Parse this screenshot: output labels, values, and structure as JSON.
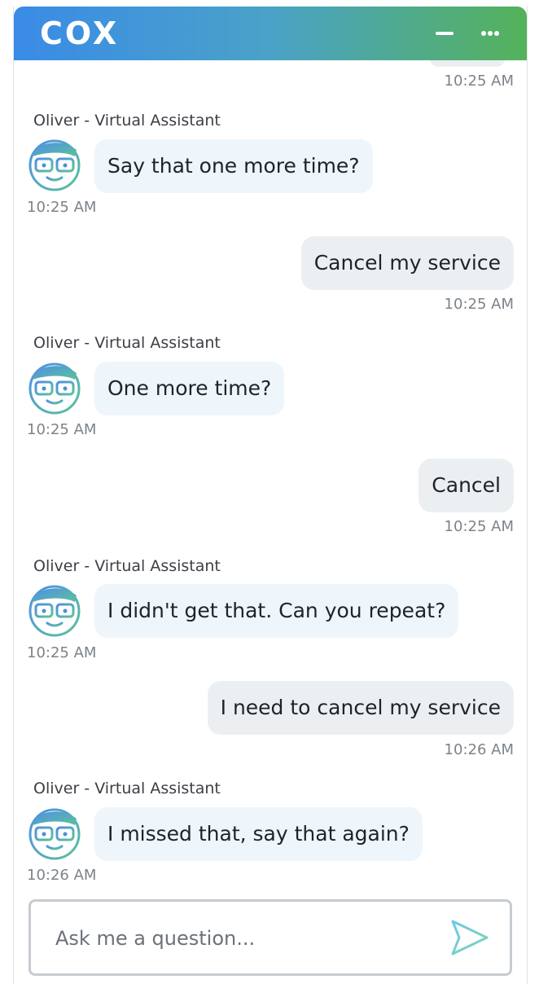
{
  "header": {
    "logo_text": "COX",
    "minimize_label": "minimize",
    "menu_label": "more options",
    "colors": {
      "gradient_start": "#3a8be6",
      "gradient_end": "#55b25a"
    }
  },
  "previous_message": {
    "time": "10:25 AM"
  },
  "messages": [
    {
      "from": "bot",
      "sender": "Oliver - Virtual Assistant",
      "text": "Say that one more time?",
      "time": "10:25 AM"
    },
    {
      "from": "user",
      "text": "Cancel my service",
      "time": "10:25 AM"
    },
    {
      "from": "bot",
      "sender": "Oliver - Virtual Assistant",
      "text": "One more time?",
      "time": "10:25 AM"
    },
    {
      "from": "user",
      "text": "Cancel",
      "time": "10:25 AM"
    },
    {
      "from": "bot",
      "sender": "Oliver - Virtual Assistant",
      "text": "I didn't get that. Can you repeat?",
      "time": "10:25 AM"
    },
    {
      "from": "user",
      "text": "I need to cancel my service",
      "time": "10:26 AM"
    },
    {
      "from": "bot",
      "sender": "Oliver - Virtual Assistant",
      "text": "I missed that, say that again?",
      "time": "10:26 AM"
    }
  ],
  "composer": {
    "placeholder": "Ask me a question...",
    "value": "",
    "send_icon": "send-arrow-icon"
  }
}
